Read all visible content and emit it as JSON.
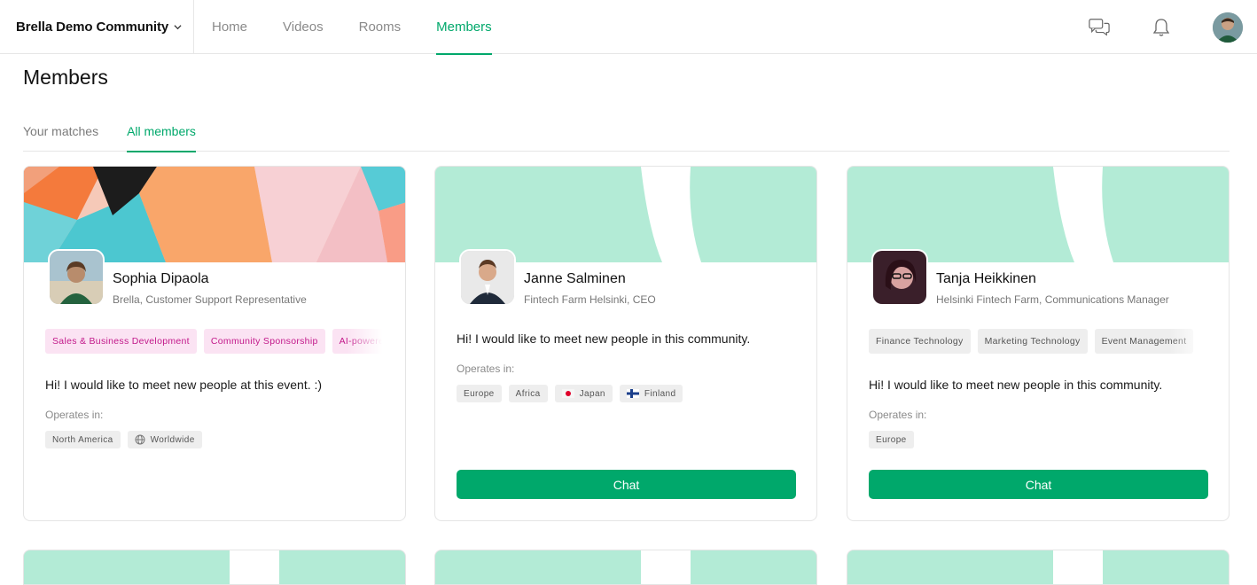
{
  "app": {
    "community_name": "Brella Demo Community"
  },
  "nav": {
    "items": [
      "Home",
      "Videos",
      "Rooms",
      "Members"
    ],
    "active": "Members"
  },
  "page": {
    "title": "Members"
  },
  "tabs": {
    "items": [
      "Your matches",
      "All members"
    ],
    "active": "All members"
  },
  "colors": {
    "accent": "#00a86b",
    "banner_mint": "#b3ebd6",
    "chip_pink_bg": "#fbe3f3",
    "chip_pink_text": "#c2188a"
  },
  "members": [
    {
      "name": "Sophia Dipaola",
      "role": "Brella, Customer Support Representative",
      "interests": [
        "Sales & Business Development",
        "Community Sponsorship",
        "AI-powered"
      ],
      "intro": "Hi! I would like to meet new people at this event. :)",
      "operates_label": "Operates in:",
      "operates_in": [
        {
          "label": "North America",
          "icon": ""
        },
        {
          "label": "Worldwide",
          "icon": "globe-icon"
        }
      ],
      "chat_label": ""
    },
    {
      "name": "Janne Salminen",
      "role": "Fintech Farm Helsinki, CEO",
      "interests": [],
      "intro": "Hi! I would like to meet new people in this community.",
      "operates_label": "Operates in:",
      "operates_in": [
        {
          "label": "Europe",
          "icon": ""
        },
        {
          "label": "Africa",
          "icon": ""
        },
        {
          "label": "Japan",
          "icon": "flag-japan-icon"
        },
        {
          "label": "Finland",
          "icon": "flag-finland-icon"
        }
      ],
      "chat_label": "Chat"
    },
    {
      "name": "Tanja Heikkinen",
      "role": "Helsinki Fintech Farm, Communications Manager",
      "interests": [
        "Finance Technology",
        "Marketing Technology",
        "Event Management"
      ],
      "intro": "Hi! I would like to meet new people in this community.",
      "operates_label": "Operates in:",
      "operates_in": [
        {
          "label": "Europe",
          "icon": ""
        }
      ],
      "chat_label": "Chat"
    }
  ]
}
